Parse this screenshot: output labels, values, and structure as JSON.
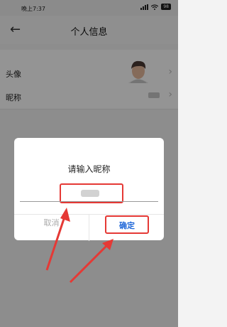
{
  "status_bar": {
    "time": "晚上7:37",
    "battery": "98"
  },
  "header": {
    "title": "个人信息",
    "back_icon": "back-arrow-icon"
  },
  "rows": {
    "avatar": {
      "label": "头像"
    },
    "nickname": {
      "label": "昵称"
    }
  },
  "dialog": {
    "title": "请输入昵称",
    "cancel_label": "取消",
    "confirm_label": "确定"
  },
  "colors": {
    "annotation": "#e53935",
    "confirm": "#1e66d8"
  }
}
